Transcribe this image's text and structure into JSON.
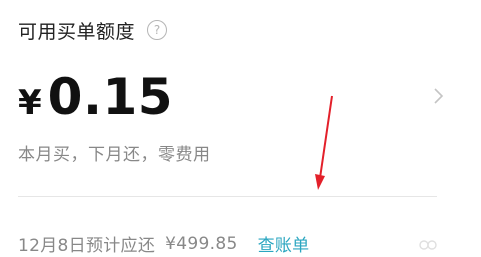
{
  "credit": {
    "title": "可用买单额度",
    "help_icon": "question-circle-icon",
    "currency_symbol": "¥",
    "amount": "0.15",
    "subtitle": "本月买，下月还，零费用"
  },
  "repayment": {
    "due_text": "12月8日预计应还",
    "due_amount": "¥499.85",
    "bill_link": "查账单"
  },
  "colors": {
    "link": "#2aa6c0",
    "annotation_arrow": "#e3202a",
    "muted_text": "#888888"
  }
}
